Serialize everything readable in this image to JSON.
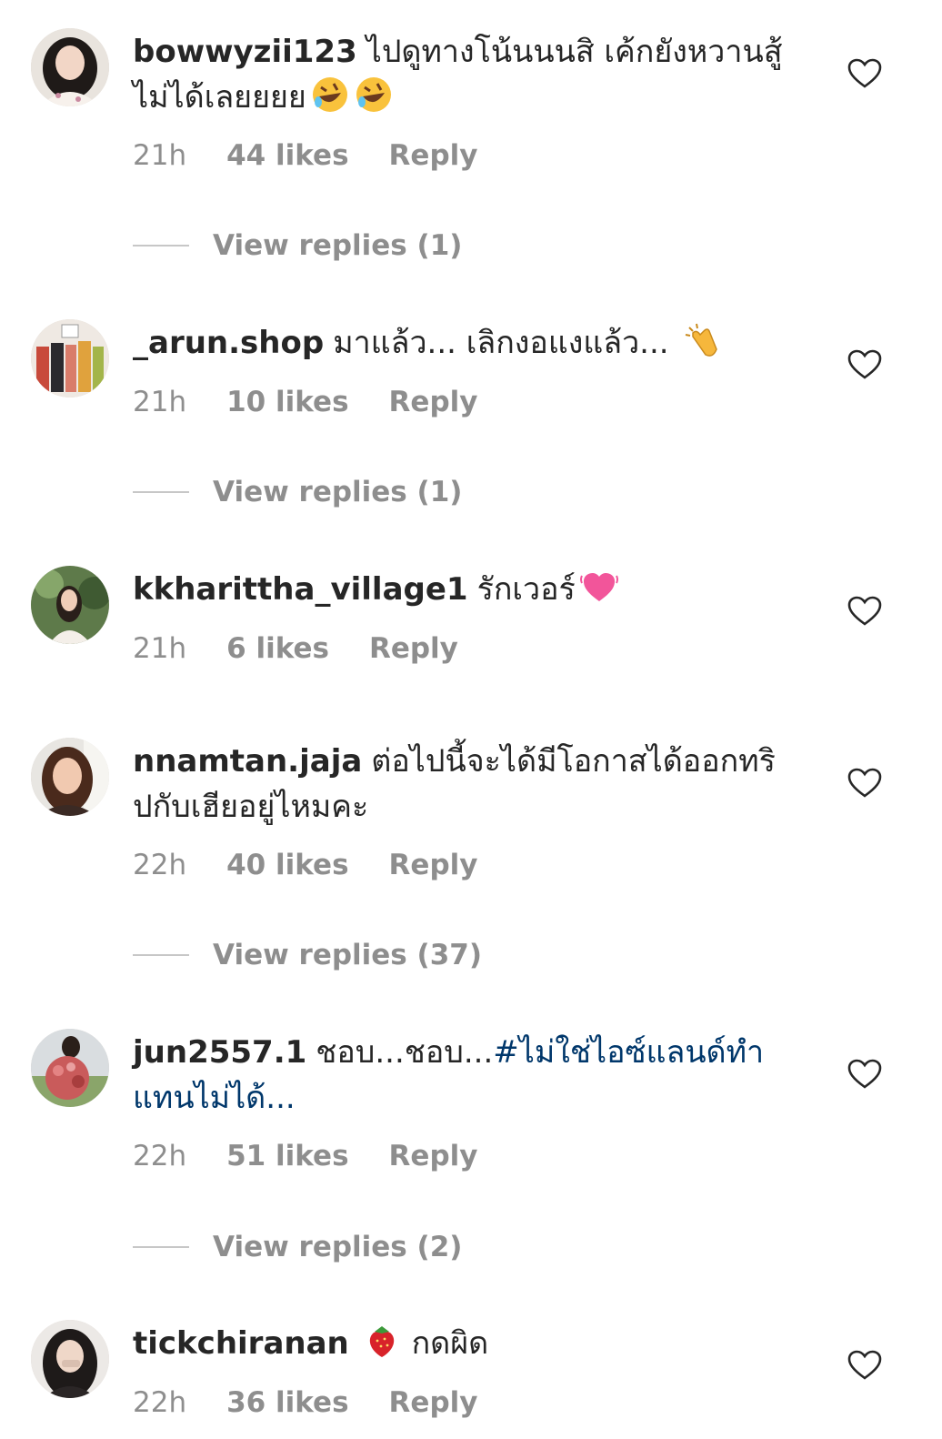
{
  "comments": [
    {
      "username": "bowwyzii123",
      "text": "ไปดูทางโน้นนนสิ เค้กยังหวานสู้ไม่ได้เลยยยย",
      "emoji": "rofl-emoji",
      "time": "21h",
      "likes": "44 likes",
      "reply": "Reply",
      "view_replies": "View replies (1)"
    },
    {
      "username": "_arun.shop",
      "text": "มาแล้ว... เลิกงอแงแล้ว...",
      "emoji": "clapping-hands-emoji",
      "time": "21h",
      "likes": "10 likes",
      "reply": "Reply",
      "view_replies": "View replies (1)"
    },
    {
      "username": "kkharittha_village1",
      "text": "รักเวอร์",
      "emoji": "heart-emoji",
      "time": "21h",
      "likes": "6 likes",
      "reply": "Reply"
    },
    {
      "username": "nnamtan.jaja",
      "text": "ต่อไปนี้จะได้มีโอกาสได้ออกทริปกับเฮียอยู่ไหมคะ",
      "time": "22h",
      "likes": "40 likes",
      "reply": "Reply",
      "view_replies": "View replies (37)"
    },
    {
      "username": "jun2557.1",
      "text": "ชอบ...ชอบ...",
      "hashtag": "#ไม่ใช่ไอซ์แลนด์ทำแทนไม่ได้...",
      "time": "22h",
      "likes": "51 likes",
      "reply": "Reply",
      "view_replies": "View replies (2)"
    },
    {
      "username": "tickchiranan",
      "emoji": "strawberry-emoji",
      "text": "กดผิด",
      "time": "22h",
      "likes": "36 likes",
      "reply": "Reply"
    }
  ],
  "colors": {
    "text": "#262626",
    "meta": "#8e8e8e",
    "hashtag": "#00376b",
    "line": "#c7c7c7"
  },
  "icons": {
    "like": "heart-outline-icon"
  }
}
